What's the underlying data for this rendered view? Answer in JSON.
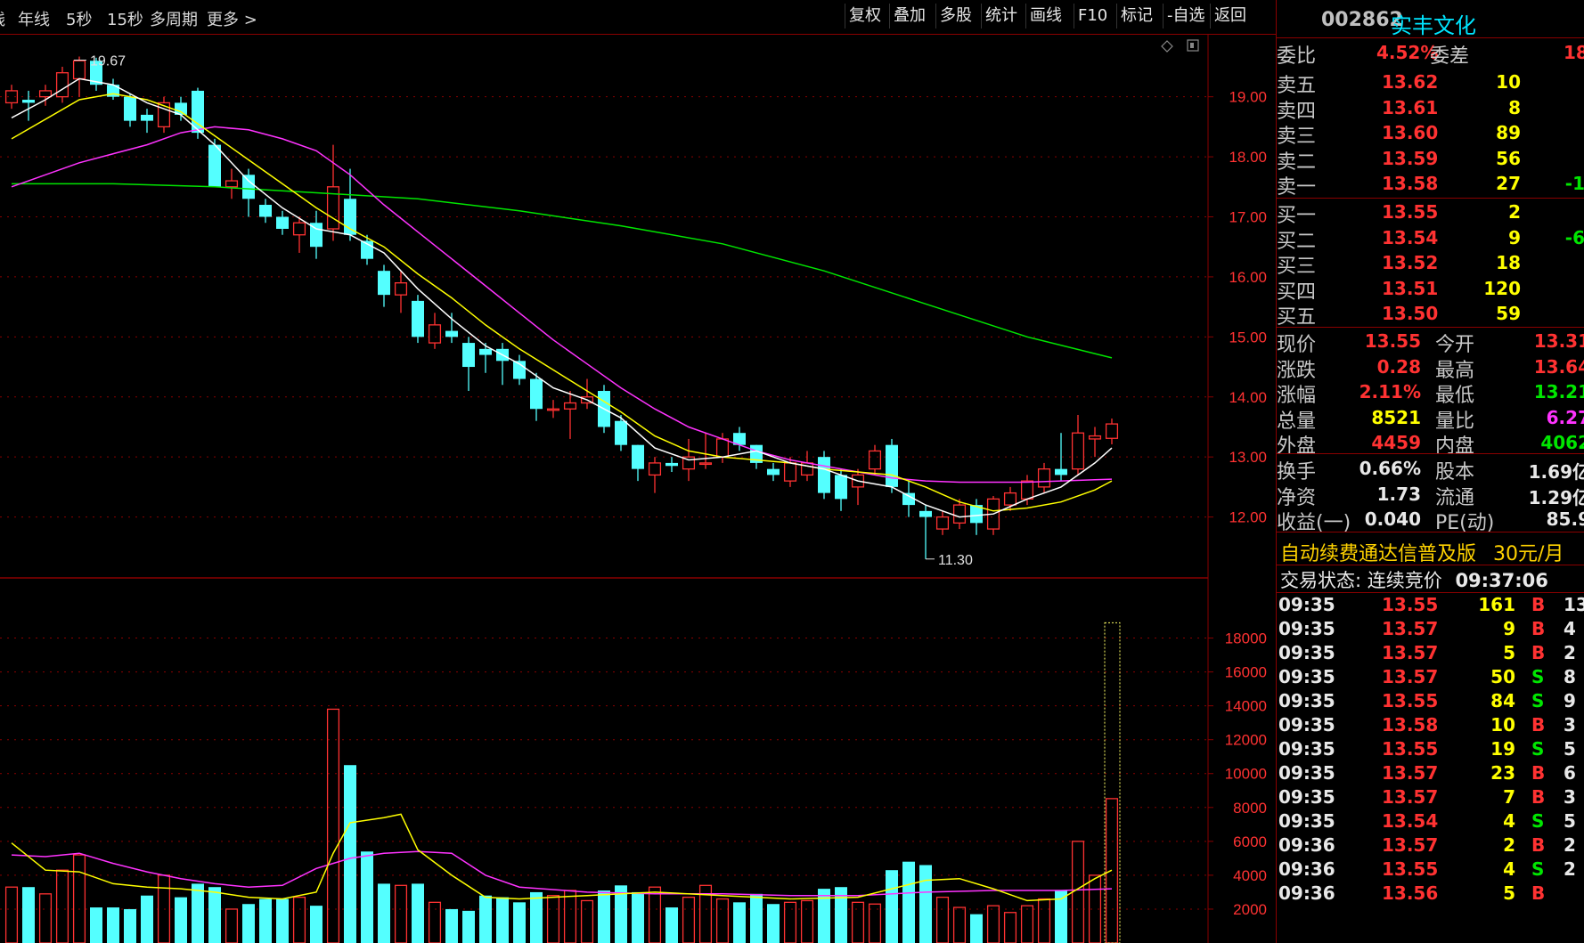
{
  "toolbar": {
    "left_items": [
      "线",
      "年线",
      "5秒",
      "15秒",
      "多周期",
      "更多 >"
    ],
    "right_buttons": [
      "复权",
      "叠加",
      "多股",
      "统计",
      "画线",
      "F10",
      "标记",
      "-自选",
      "返回"
    ]
  },
  "stock": {
    "code": "002862",
    "name": "实丰文化"
  },
  "order_ratio": {
    "label1": "委比",
    "value1": "4.52%",
    "label2": "委差",
    "value2": "18"
  },
  "sell_orders": [
    {
      "label": "卖五",
      "price": "13.62",
      "vol": "10",
      "chg": ""
    },
    {
      "label": "卖四",
      "price": "13.61",
      "vol": "8",
      "chg": ""
    },
    {
      "label": "卖三",
      "price": "13.60",
      "vol": "89",
      "chg": ""
    },
    {
      "label": "卖二",
      "price": "13.59",
      "vol": "56",
      "chg": ""
    },
    {
      "label": "卖一",
      "price": "13.58",
      "vol": "27",
      "chg": "-1"
    }
  ],
  "buy_orders": [
    {
      "label": "买一",
      "price": "13.55",
      "vol": "2",
      "chg": ""
    },
    {
      "label": "买二",
      "price": "13.54",
      "vol": "9",
      "chg": "-6"
    },
    {
      "label": "买三",
      "price": "13.52",
      "vol": "18",
      "chg": ""
    },
    {
      "label": "买四",
      "price": "13.51",
      "vol": "120",
      "chg": ""
    },
    {
      "label": "买五",
      "price": "13.50",
      "vol": "59",
      "chg": ""
    }
  ],
  "quote_stats": [
    {
      "l1": "现价",
      "v1": "13.55",
      "l2": "今开",
      "v2": "13.31",
      "c1": "red",
      "c2": "red"
    },
    {
      "l1": "涨跌",
      "v1": "0.28",
      "l2": "最高",
      "v2": "13.64",
      "c1": "red",
      "c2": "red"
    },
    {
      "l1": "涨幅",
      "v1": "2.11%",
      "l2": "最低",
      "v2": "13.21",
      "c1": "red",
      "c2": "grn"
    },
    {
      "l1": "总量",
      "v1": "8521",
      "l2": "量比",
      "v2": "6.27",
      "c1": "yel",
      "c2": "mag"
    },
    {
      "l1": "外盘",
      "v1": "4459",
      "l2": "内盘",
      "v2": "4062",
      "c1": "red",
      "c2": "grn"
    }
  ],
  "fundamentals": [
    {
      "l1": "换手",
      "v1": "0.66%",
      "l2": "股本",
      "v2": "1.69亿"
    },
    {
      "l1": "净资",
      "v1": "1.73",
      "l2": "流通",
      "v2": "1.29亿"
    },
    {
      "l1": "收益(一)",
      "v1": "0.040",
      "l2": "PE(动)",
      "v2": "85.9"
    }
  ],
  "promo": {
    "text": "自动续费通达信普及版",
    "price": "30元/月"
  },
  "trade_status": {
    "label": "交易状态: 连续竞价",
    "time": "09:37:06"
  },
  "ticks": [
    {
      "time": "09:35",
      "price": "13.55",
      "vol": "161",
      "side": "B",
      "extra": "13"
    },
    {
      "time": "09:35",
      "price": "13.57",
      "vol": "9",
      "side": "B",
      "extra": "4"
    },
    {
      "time": "09:35",
      "price": "13.57",
      "vol": "5",
      "side": "B",
      "extra": "2"
    },
    {
      "time": "09:35",
      "price": "13.57",
      "vol": "50",
      "side": "S",
      "extra": "8"
    },
    {
      "time": "09:35",
      "price": "13.55",
      "vol": "84",
      "side": "S",
      "extra": "9"
    },
    {
      "time": "09:35",
      "price": "13.58",
      "vol": "10",
      "side": "B",
      "extra": "3"
    },
    {
      "time": "09:35",
      "price": "13.55",
      "vol": "19",
      "side": "S",
      "extra": "5"
    },
    {
      "time": "09:35",
      "price": "13.57",
      "vol": "23",
      "side": "B",
      "extra": "6"
    },
    {
      "time": "09:35",
      "price": "13.57",
      "vol": "7",
      "side": "B",
      "extra": "3"
    },
    {
      "time": "09:35",
      "price": "13.54",
      "vol": "4",
      "side": "S",
      "extra": "5"
    },
    {
      "time": "09:36",
      "price": "13.57",
      "vol": "2",
      "side": "B",
      "extra": "2"
    },
    {
      "time": "09:36",
      "price": "13.55",
      "vol": "4",
      "side": "S",
      "extra": "2"
    },
    {
      "time": "09:36",
      "price": "13.56",
      "vol": "5",
      "side": "B",
      "extra": ""
    }
  ],
  "colors": {
    "up": "#ff3232",
    "down": "#54ffff",
    "ma5": "#ffffff",
    "ma10": "#ffff00",
    "ma20": "#ff33ff",
    "ma60": "#00e600",
    "grid": "#8a0000"
  },
  "chart_data": {
    "type": "candlestick",
    "price_axis": {
      "ticks": [
        12,
        13,
        14,
        15,
        16,
        17,
        18,
        19
      ],
      "labels": [
        "12.00",
        "13.00",
        "14.00",
        "15.00",
        "16.00",
        "17.00",
        "18.00",
        "19.00"
      ],
      "range": [
        11.0,
        19.9
      ]
    },
    "volume_axis": {
      "ticks": [
        2000,
        4000,
        6000,
        8000,
        10000,
        12000,
        14000,
        16000,
        18000
      ],
      "labels": [
        "2000",
        "4000",
        "6000",
        "8000",
        "10000",
        "12000",
        "14000",
        "16000",
        "18000"
      ],
      "range": [
        0,
        19500
      ]
    },
    "annotations": {
      "high": "19.67",
      "low": "11.30"
    },
    "candles": [
      {
        "o": 18.9,
        "c": 19.1,
        "h": 19.2,
        "l": 18.8,
        "v": 3300
      },
      {
        "o": 18.95,
        "c": 18.9,
        "h": 19.1,
        "l": 18.6,
        "v": 3300
      },
      {
        "o": 19.0,
        "c": 19.1,
        "h": 19.2,
        "l": 18.85,
        "v": 2900
      },
      {
        "o": 19.0,
        "c": 19.4,
        "h": 19.5,
        "l": 18.9,
        "v": 4300
      },
      {
        "o": 19.3,
        "c": 19.6,
        "h": 19.67,
        "l": 19.0,
        "v": 5200
      },
      {
        "o": 19.6,
        "c": 19.2,
        "h": 19.65,
        "l": 19.1,
        "v": 2100
      },
      {
        "o": 19.2,
        "c": 19.0,
        "h": 19.3,
        "l": 18.95,
        "v": 2100
      },
      {
        "o": 19.0,
        "c": 18.6,
        "h": 19.05,
        "l": 18.5,
        "v": 2000
      },
      {
        "o": 18.7,
        "c": 18.6,
        "h": 18.8,
        "l": 18.4,
        "v": 2800
      },
      {
        "o": 18.5,
        "c": 18.9,
        "h": 19.0,
        "l": 18.4,
        "v": 4000
      },
      {
        "o": 18.9,
        "c": 18.7,
        "h": 19.0,
        "l": 18.6,
        "v": 2700
      },
      {
        "o": 19.1,
        "c": 18.4,
        "h": 19.15,
        "l": 18.3,
        "v": 3500
      },
      {
        "o": 18.2,
        "c": 17.5,
        "h": 18.3,
        "l": 17.5,
        "v": 3300
      },
      {
        "o": 17.5,
        "c": 17.6,
        "h": 17.8,
        "l": 17.3,
        "v": 2000
      },
      {
        "o": 17.7,
        "c": 17.3,
        "h": 17.8,
        "l": 17.0,
        "v": 2300
      },
      {
        "o": 17.2,
        "c": 17.0,
        "h": 17.3,
        "l": 16.9,
        "v": 2600
      },
      {
        "o": 17.0,
        "c": 16.8,
        "h": 17.1,
        "l": 16.7,
        "v": 2600
      },
      {
        "o": 16.7,
        "c": 16.9,
        "h": 17.0,
        "l": 16.4,
        "v": 2700
      },
      {
        "o": 16.9,
        "c": 16.5,
        "h": 17.1,
        "l": 16.3,
        "v": 2200
      },
      {
        "o": 16.8,
        "c": 17.5,
        "h": 18.2,
        "l": 16.6,
        "v": 13800
      },
      {
        "o": 17.3,
        "c": 16.7,
        "h": 17.8,
        "l": 16.6,
        "v": 10500
      },
      {
        "o": 16.6,
        "c": 16.3,
        "h": 16.7,
        "l": 16.2,
        "v": 5400
      },
      {
        "o": 16.1,
        "c": 15.7,
        "h": 16.2,
        "l": 15.5,
        "v": 3500
      },
      {
        "o": 15.7,
        "c": 15.9,
        "h": 16.1,
        "l": 15.4,
        "v": 3400
      },
      {
        "o": 15.6,
        "c": 15.0,
        "h": 15.7,
        "l": 14.9,
        "v": 3500
      },
      {
        "o": 14.9,
        "c": 15.2,
        "h": 15.4,
        "l": 14.8,
        "v": 2400
      },
      {
        "o": 15.1,
        "c": 15.0,
        "h": 15.4,
        "l": 14.9,
        "v": 2000
      },
      {
        "o": 14.9,
        "c": 14.5,
        "h": 15.0,
        "l": 14.1,
        "v": 1900
      },
      {
        "o": 14.8,
        "c": 14.7,
        "h": 14.9,
        "l": 14.4,
        "v": 2800
      },
      {
        "o": 14.8,
        "c": 14.6,
        "h": 14.9,
        "l": 14.2,
        "v": 2700
      },
      {
        "o": 14.6,
        "c": 14.3,
        "h": 14.7,
        "l": 14.2,
        "v": 2400
      },
      {
        "o": 14.3,
        "c": 13.8,
        "h": 14.4,
        "l": 13.6,
        "v": 3000
      },
      {
        "o": 13.8,
        "c": 13.8,
        "h": 13.95,
        "l": 13.65,
        "v": 2800
      },
      {
        "o": 13.8,
        "c": 13.9,
        "h": 14.1,
        "l": 13.3,
        "v": 3100
      },
      {
        "o": 13.9,
        "c": 14.0,
        "h": 14.3,
        "l": 13.8,
        "v": 2500
      },
      {
        "o": 14.1,
        "c": 13.5,
        "h": 14.2,
        "l": 13.4,
        "v": 3100
      },
      {
        "o": 13.6,
        "c": 13.2,
        "h": 13.7,
        "l": 13.1,
        "v": 3400
      },
      {
        "o": 13.2,
        "c": 12.8,
        "h": 13.2,
        "l": 12.6,
        "v": 3000
      },
      {
        "o": 12.7,
        "c": 12.9,
        "h": 13.0,
        "l": 12.4,
        "v": 3300
      },
      {
        "o": 12.9,
        "c": 12.85,
        "h": 13.0,
        "l": 12.75,
        "v": 2100
      },
      {
        "o": 12.8,
        "c": 13.0,
        "h": 13.3,
        "l": 12.6,
        "v": 2700
      },
      {
        "o": 12.9,
        "c": 12.9,
        "h": 13.4,
        "l": 12.8,
        "v": 3400
      },
      {
        "o": 13.0,
        "c": 13.3,
        "h": 13.4,
        "l": 12.9,
        "v": 2600
      },
      {
        "o": 13.4,
        "c": 13.2,
        "h": 13.5,
        "l": 13.1,
        "v": 2400
      },
      {
        "o": 13.2,
        "c": 12.9,
        "h": 13.2,
        "l": 12.8,
        "v": 2900
      },
      {
        "o": 12.8,
        "c": 12.7,
        "h": 12.9,
        "l": 12.6,
        "v": 2300
      },
      {
        "o": 12.6,
        "c": 12.9,
        "h": 13.0,
        "l": 12.5,
        "v": 2400
      },
      {
        "o": 12.7,
        "c": 12.9,
        "h": 13.1,
        "l": 12.6,
        "v": 2500
      },
      {
        "o": 13.0,
        "c": 12.4,
        "h": 13.1,
        "l": 12.3,
        "v": 3200
      },
      {
        "o": 12.7,
        "c": 12.3,
        "h": 12.8,
        "l": 12.1,
        "v": 3300
      },
      {
        "o": 12.5,
        "c": 12.7,
        "h": 12.8,
        "l": 12.2,
        "v": 2400
      },
      {
        "o": 12.8,
        "c": 13.1,
        "h": 13.2,
        "l": 12.7,
        "v": 2300
      },
      {
        "o": 13.2,
        "c": 12.5,
        "h": 13.3,
        "l": 12.4,
        "v": 4300
      },
      {
        "o": 12.4,
        "c": 12.2,
        "h": 12.6,
        "l": 12.0,
        "v": 4800
      },
      {
        "o": 12.1,
        "c": 12.0,
        "h": 12.2,
        "l": 11.3,
        "v": 4600
      },
      {
        "o": 11.8,
        "c": 12.0,
        "h": 12.1,
        "l": 11.7,
        "v": 2700
      },
      {
        "o": 11.9,
        "c": 12.2,
        "h": 12.3,
        "l": 11.8,
        "v": 2100
      },
      {
        "o": 12.2,
        "c": 11.9,
        "h": 12.3,
        "l": 11.7,
        "v": 1700
      },
      {
        "o": 11.8,
        "c": 12.3,
        "h": 12.35,
        "l": 11.7,
        "v": 2200
      },
      {
        "o": 12.2,
        "c": 12.4,
        "h": 12.5,
        "l": 12.1,
        "v": 1800
      },
      {
        "o": 12.3,
        "c": 12.6,
        "h": 12.7,
        "l": 12.2,
        "v": 2200
      },
      {
        "o": 12.5,
        "c": 12.8,
        "h": 12.9,
        "l": 12.4,
        "v": 2600
      },
      {
        "o": 12.8,
        "c": 12.7,
        "h": 13.4,
        "l": 12.6,
        "v": 3100
      },
      {
        "o": 12.8,
        "c": 13.4,
        "h": 13.7,
        "l": 12.7,
        "v": 6000
      },
      {
        "o": 13.3,
        "c": 13.35,
        "h": 13.5,
        "l": 13.0,
        "v": 4000
      },
      {
        "o": 13.31,
        "c": 13.55,
        "h": 13.64,
        "l": 13.21,
        "v": 8521
      }
    ],
    "ma5": [
      [
        0,
        18.65
      ],
      [
        2,
        18.95
      ],
      [
        4,
        19.3
      ],
      [
        6,
        19.2
      ],
      [
        8,
        18.9
      ],
      [
        10,
        18.7
      ],
      [
        12,
        18.2
      ],
      [
        14,
        17.6
      ],
      [
        16,
        17.15
      ],
      [
        18,
        16.8
      ],
      [
        20,
        16.7
      ],
      [
        22,
        16.4
      ],
      [
        24,
        15.8
      ],
      [
        26,
        15.3
      ],
      [
        28,
        14.85
      ],
      [
        30,
        14.55
      ],
      [
        32,
        14.15
      ],
      [
        34,
        13.95
      ],
      [
        36,
        13.65
      ],
      [
        38,
        13.15
      ],
      [
        40,
        12.95
      ],
      [
        42,
        13.0
      ],
      [
        44,
        13.1
      ],
      [
        46,
        12.9
      ],
      [
        48,
        12.8
      ],
      [
        50,
        12.6
      ],
      [
        52,
        12.5
      ],
      [
        54,
        12.2
      ],
      [
        56,
        12.0
      ],
      [
        58,
        12.05
      ],
      [
        60,
        12.3
      ],
      [
        62,
        12.5
      ],
      [
        64,
        12.9
      ],
      [
        65,
        13.15
      ]
    ],
    "ma10": [
      [
        0,
        18.3
      ],
      [
        4,
        18.95
      ],
      [
        6,
        19.05
      ],
      [
        8,
        18.95
      ],
      [
        10,
        18.75
      ],
      [
        12,
        18.35
      ],
      [
        14,
        17.95
      ],
      [
        16,
        17.55
      ],
      [
        18,
        17.15
      ],
      [
        20,
        16.8
      ],
      [
        22,
        16.5
      ],
      [
        24,
        16.05
      ],
      [
        26,
        15.65
      ],
      [
        28,
        15.2
      ],
      [
        30,
        14.8
      ],
      [
        32,
        14.45
      ],
      [
        34,
        14.1
      ],
      [
        36,
        13.75
      ],
      [
        38,
        13.35
      ],
      [
        40,
        13.1
      ],
      [
        42,
        13.0
      ],
      [
        44,
        12.95
      ],
      [
        46,
        12.9
      ],
      [
        48,
        12.8
      ],
      [
        50,
        12.75
      ],
      [
        52,
        12.7
      ],
      [
        54,
        12.5
      ],
      [
        56,
        12.25
      ],
      [
        58,
        12.1
      ],
      [
        60,
        12.15
      ],
      [
        62,
        12.25
      ],
      [
        64,
        12.45
      ],
      [
        65,
        12.6
      ]
    ],
    "ma20": [
      [
        0,
        17.5
      ],
      [
        4,
        17.9
      ],
      [
        8,
        18.2
      ],
      [
        10,
        18.4
      ],
      [
        12,
        18.5
      ],
      [
        14,
        18.45
      ],
      [
        16,
        18.3
      ],
      [
        18,
        18.1
      ],
      [
        20,
        17.7
      ],
      [
        22,
        17.2
      ],
      [
        24,
        16.75
      ],
      [
        26,
        16.3
      ],
      [
        28,
        15.85
      ],
      [
        30,
        15.4
      ],
      [
        32,
        14.95
      ],
      [
        34,
        14.55
      ],
      [
        36,
        14.15
      ],
      [
        38,
        13.8
      ],
      [
        40,
        13.5
      ],
      [
        42,
        13.3
      ],
      [
        44,
        13.1
      ],
      [
        46,
        12.95
      ],
      [
        48,
        12.85
      ],
      [
        50,
        12.75
      ],
      [
        52,
        12.65
      ],
      [
        54,
        12.6
      ],
      [
        56,
        12.58
      ],
      [
        58,
        12.58
      ],
      [
        60,
        12.58
      ],
      [
        62,
        12.6
      ],
      [
        64,
        12.62
      ],
      [
        65,
        12.63
      ]
    ],
    "ma60": [
      [
        0,
        17.55
      ],
      [
        6,
        17.55
      ],
      [
        12,
        17.5
      ],
      [
        18,
        17.4
      ],
      [
        24,
        17.3
      ],
      [
        30,
        17.1
      ],
      [
        36,
        16.85
      ],
      [
        42,
        16.55
      ],
      [
        48,
        16.1
      ],
      [
        54,
        15.55
      ],
      [
        60,
        15.0
      ],
      [
        65,
        14.65
      ]
    ],
    "vol_ma1": [
      [
        0,
        5900
      ],
      [
        2,
        4300
      ],
      [
        4,
        4200
      ],
      [
        6,
        3500
      ],
      [
        8,
        3300
      ],
      [
        10,
        3200
      ],
      [
        12,
        3000
      ],
      [
        14,
        2700
      ],
      [
        16,
        2600
      ],
      [
        18,
        3000
      ],
      [
        19,
        5300
      ],
      [
        20,
        7100
      ],
      [
        22,
        7400
      ],
      [
        23,
        7600
      ],
      [
        24,
        5500
      ],
      [
        26,
        4000
      ],
      [
        28,
        2700
      ],
      [
        30,
        2600
      ],
      [
        34,
        2800
      ],
      [
        38,
        3000
      ],
      [
        42,
        2800
      ],
      [
        46,
        2600
      ],
      [
        50,
        2700
      ],
      [
        54,
        3700
      ],
      [
        56,
        3800
      ],
      [
        58,
        3200
      ],
      [
        60,
        2500
      ],
      [
        62,
        2600
      ],
      [
        64,
        3800
      ],
      [
        65,
        4300
      ]
    ],
    "vol_ma2": [
      [
        0,
        5200
      ],
      [
        2,
        5100
      ],
      [
        4,
        5300
      ],
      [
        6,
        4700
      ],
      [
        8,
        4200
      ],
      [
        10,
        3800
      ],
      [
        12,
        3500
      ],
      [
        14,
        3300
      ],
      [
        16,
        3400
      ],
      [
        18,
        4400
      ],
      [
        20,
        5000
      ],
      [
        22,
        5300
      ],
      [
        24,
        5400
      ],
      [
        26,
        5300
      ],
      [
        28,
        4000
      ],
      [
        30,
        3300
      ],
      [
        34,
        3000
      ],
      [
        38,
        2900
      ],
      [
        42,
        2900
      ],
      [
        46,
        2800
      ],
      [
        50,
        2800
      ],
      [
        54,
        3000
      ],
      [
        58,
        3100
      ],
      [
        62,
        3100
      ],
      [
        65,
        3200
      ]
    ]
  }
}
